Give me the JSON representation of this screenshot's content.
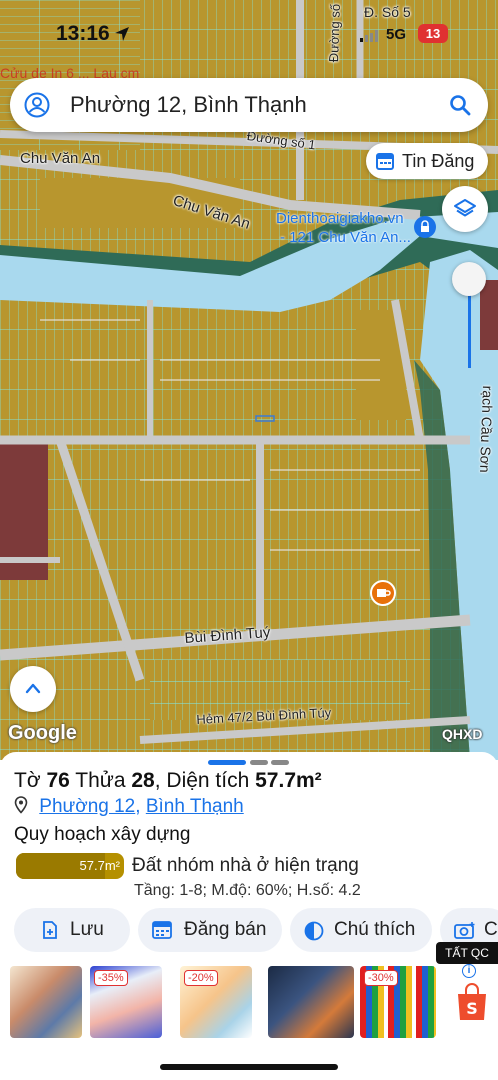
{
  "status_bar": {
    "time": "13:16",
    "network": "5G",
    "battery": "13"
  },
  "search": {
    "value": "Phường 12, Bình Thạnh"
  },
  "map": {
    "labels": {
      "chu_van_an_1": "Chu Văn An",
      "chu_van_an_2": "Chu Văn An",
      "duong_so_1": "Đường số 1",
      "duong_so_top": "Đường số",
      "d_so_5": "Đ. Số 5",
      "rach_cau_son": "rạch Cầu Sơn",
      "bui_dinh_tuy": "Bùi Đình Tuý",
      "hem_47": "Hẻm 47/2 Bùi Đình Túy",
      "top_faded": "Cửu de In 6 ... Lau cm"
    },
    "poi": {
      "name": "Dienthoaigiakho.vn",
      "address": "- 121 Chu Văn An..."
    },
    "tin_dang_label": "Tin Đăng",
    "google_logo": "Google",
    "qhxd_label": "QHXD",
    "colors": {
      "land": "#b8962e",
      "river": "#a9d9ee",
      "greenery": "#2f6b57",
      "road": "#c9c9c9",
      "parcel_lines": "#7fe3d4",
      "red_zone": "#7d3a3a"
    }
  },
  "parcel": {
    "title_prefix": "Tờ",
    "sheet_no": "76",
    "parcel_prefix": "Thửa",
    "parcel_no": "28",
    "area_prefix": "Diện tích",
    "area": "57.7m²",
    "ward": "Phường 12",
    "separator": ",",
    "district": "Bình Thạnh",
    "plan_heading": "Quy hoạch xây dựng",
    "area_bar_value": "57.7m²",
    "area_bar_fill": 0.82,
    "zone_type": "Đất nhóm nhà ở hiện trạng",
    "zone_params": "Tầng: 1-8; M.độ: 60%; H.số: 4.2"
  },
  "actions": {
    "save": "Lưu",
    "post_sale": "Đăng bán",
    "legend": "Chú thích",
    "capture": "C"
  },
  "ads": {
    "close_all": "TẤT QC",
    "badges": [
      "-35%",
      "-20%",
      "-30%"
    ],
    "info": "i"
  },
  "pager": {
    "active": 0,
    "count": 3
  }
}
